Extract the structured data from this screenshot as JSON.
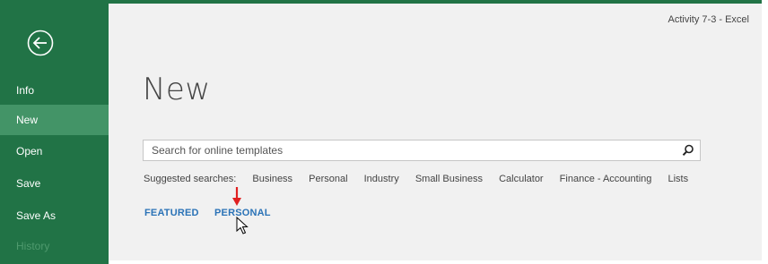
{
  "window": {
    "title": "Activity 7-3 - Excel"
  },
  "sidebar": {
    "back_icon": "back-arrow-circle-icon",
    "items": [
      {
        "label": "Info"
      },
      {
        "label": "New"
      },
      {
        "label": "Open"
      },
      {
        "label": "Save"
      },
      {
        "label": "Save As"
      },
      {
        "label": "History"
      }
    ],
    "active_index": 1
  },
  "main": {
    "heading": "New",
    "search": {
      "placeholder": "Search for online templates",
      "value": "",
      "icon": "search-icon"
    },
    "suggested": {
      "label": "Suggested searches:",
      "links": [
        "Business",
        "Personal",
        "Industry",
        "Small Business",
        "Calculator",
        "Finance - Accounting",
        "Lists"
      ]
    },
    "tabs": [
      {
        "label": "FEATURED"
      },
      {
        "label": "PERSONAL"
      }
    ]
  },
  "annotations": {
    "arrow_color": "#e02020",
    "cursor": "pointer-cursor-icon"
  },
  "colors": {
    "accent": "#217346",
    "active_item": "#439467",
    "link": "#2b73b7",
    "background": "#f1f1f1"
  }
}
